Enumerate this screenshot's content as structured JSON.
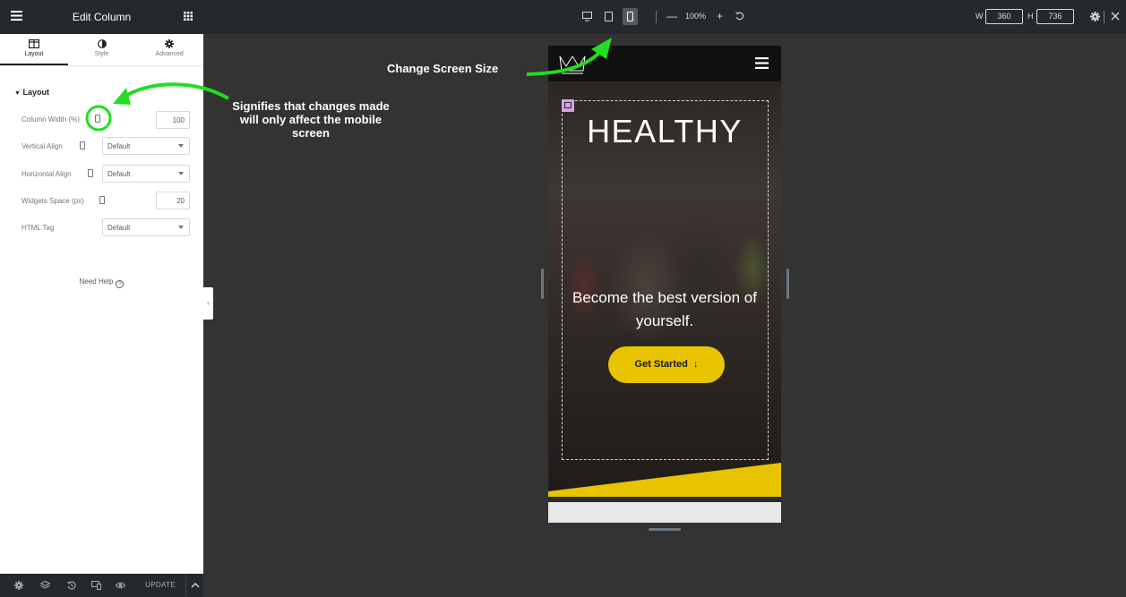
{
  "panel": {
    "title": "Edit Column",
    "tabs": [
      {
        "label": "Layout",
        "icon": "columns-icon",
        "active": true
      },
      {
        "label": "Style",
        "icon": "contrast-icon",
        "active": false
      },
      {
        "label": "Advanced",
        "icon": "gear-icon",
        "active": false
      }
    ],
    "section_title": "Layout",
    "fields": {
      "column_width": {
        "label": "Column Width (%)",
        "value": "100"
      },
      "vertical_align": {
        "label": "Vertical Align",
        "value": "Default"
      },
      "horizontal_align": {
        "label": "Horizontal Align",
        "value": "Default"
      },
      "widgets_space": {
        "label": "Widgets Space (px)",
        "value": "20"
      },
      "html_tag": {
        "label": "HTML Tag",
        "value": "Default"
      }
    },
    "need_help": "Need Help",
    "help_icon": "?",
    "footer": {
      "update_label": "UPDATE"
    }
  },
  "topbar": {
    "zoom": "100%",
    "zoom_minus": "—",
    "zoom_plus": "+",
    "width_label": "W",
    "width_value": "360",
    "height_label": "H",
    "height_value": "736"
  },
  "preview": {
    "hero_title": "HEALTHY",
    "hero_subtitle": "Become the best version of yourself.",
    "cta_label": "Get Started",
    "cta_arrow": "↓"
  },
  "annotations": {
    "screen_size": "Change Screen Size",
    "mobile_note": "Signifies that changes made will only affect the mobile screen"
  },
  "colors": {
    "annotation_green": "#22dd22",
    "cta_yellow": "#e8c400",
    "panel_dark": "#26292c",
    "canvas_bg": "#333333",
    "column_handle": "#d5a3e0"
  }
}
